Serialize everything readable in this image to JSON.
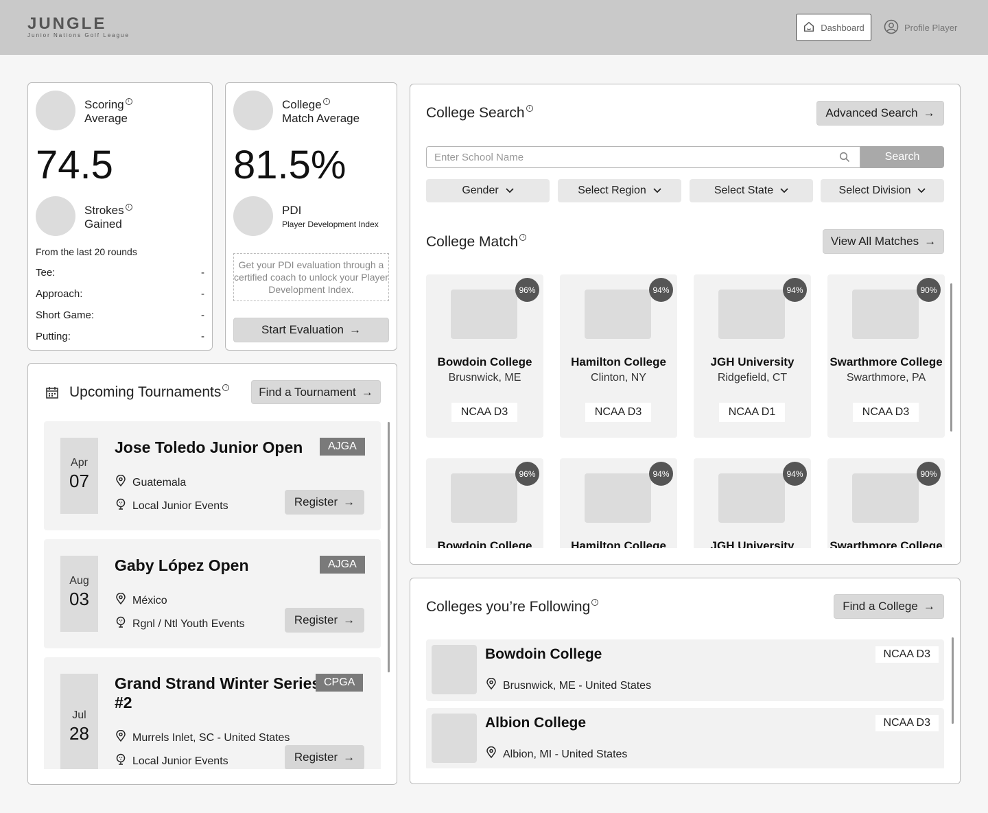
{
  "header": {
    "logo_text": "JUNGLE",
    "logo_sub": "Junior Nations Golf League",
    "dashboard_label": "Dashboard",
    "profile_label": "Profile Player"
  },
  "stats": {
    "scoring_label_1": "Scoring",
    "scoring_label_2": "Average",
    "scoring_value": "74.5",
    "strokes_label_1": "Strokes",
    "strokes_label_2": "Gained",
    "from_rounds": "From the last 20 rounds",
    "rows": [
      {
        "label": "Tee:",
        "value": "-"
      },
      {
        "label": "Approach:",
        "value": "-"
      },
      {
        "label": "Short Game:",
        "value": "-"
      },
      {
        "label": "Putting:",
        "value": "-"
      }
    ]
  },
  "college_match_avg": {
    "label_1": "College",
    "label_2": "Match Average",
    "value": "81.5%",
    "pdi_label": "PDI",
    "pdi_sub": "Player Development Index",
    "pdi_note": "Get your PDI evaluation through a certified coach to unlock your Player Development Index.",
    "start_btn": "Start Evaluation"
  },
  "tournaments": {
    "title": "Upcoming Tournaments",
    "find_btn": "Find a Tournament",
    "register_label": "Register",
    "items": [
      {
        "month": "Apr",
        "day": "07",
        "name": "Jose Toledo Junior Open",
        "tag": "AJGA",
        "location": "Guatemala",
        "category": "Local Junior Events"
      },
      {
        "month": "Aug",
        "day": "03",
        "name": "Gaby López Open",
        "tag": "AJGA",
        "location": "México",
        "category": "Rgnl / Ntl Youth Events"
      },
      {
        "month": "Jul",
        "day": "28",
        "name_1": "Grand Strand Winter Series",
        "name_2": "#2",
        "tag": "CPGA",
        "location": "Murrels Inlet, SC - United States",
        "category": "Local Junior Events"
      }
    ]
  },
  "college_search": {
    "title": "College Search",
    "advanced_btn": "Advanced Search",
    "placeholder": "Enter School Name",
    "search_btn": "Search",
    "filters": [
      "Gender",
      "Select Region",
      "Select State",
      "Select Division"
    ]
  },
  "college_match": {
    "title": "College Match",
    "view_all_btn": "View All Matches",
    "cards": [
      {
        "pct": "96%",
        "name": "Bowdoin College",
        "loc": "Brusnwick, ME",
        "div": "NCAA D3"
      },
      {
        "pct": "94%",
        "name": "Hamilton College",
        "loc": "Clinton, NY",
        "div": "NCAA D3"
      },
      {
        "pct": "94%",
        "name": "JGH University",
        "loc": "Ridgefield, CT",
        "div": "NCAA D1"
      },
      {
        "pct": "90%",
        "name": "Swarthmore College",
        "loc": "Swarthmore, PA",
        "div": "NCAA D3"
      },
      {
        "pct": "96%",
        "name": "Bowdoin College"
      },
      {
        "pct": "94%",
        "name": "Hamilton College"
      },
      {
        "pct": "94%",
        "name": "JGH University"
      },
      {
        "pct": "90%",
        "name": "Swarthmore College"
      }
    ]
  },
  "following": {
    "title": "Colleges you’re Following",
    "find_btn": "Find a College",
    "items": [
      {
        "name": "Bowdoin College",
        "loc": "Brusnwick, ME - United States",
        "div": "NCAA D3"
      },
      {
        "name": "Albion College",
        "loc": "Albion, MI - United States",
        "div": "NCAA D3"
      }
    ]
  }
}
